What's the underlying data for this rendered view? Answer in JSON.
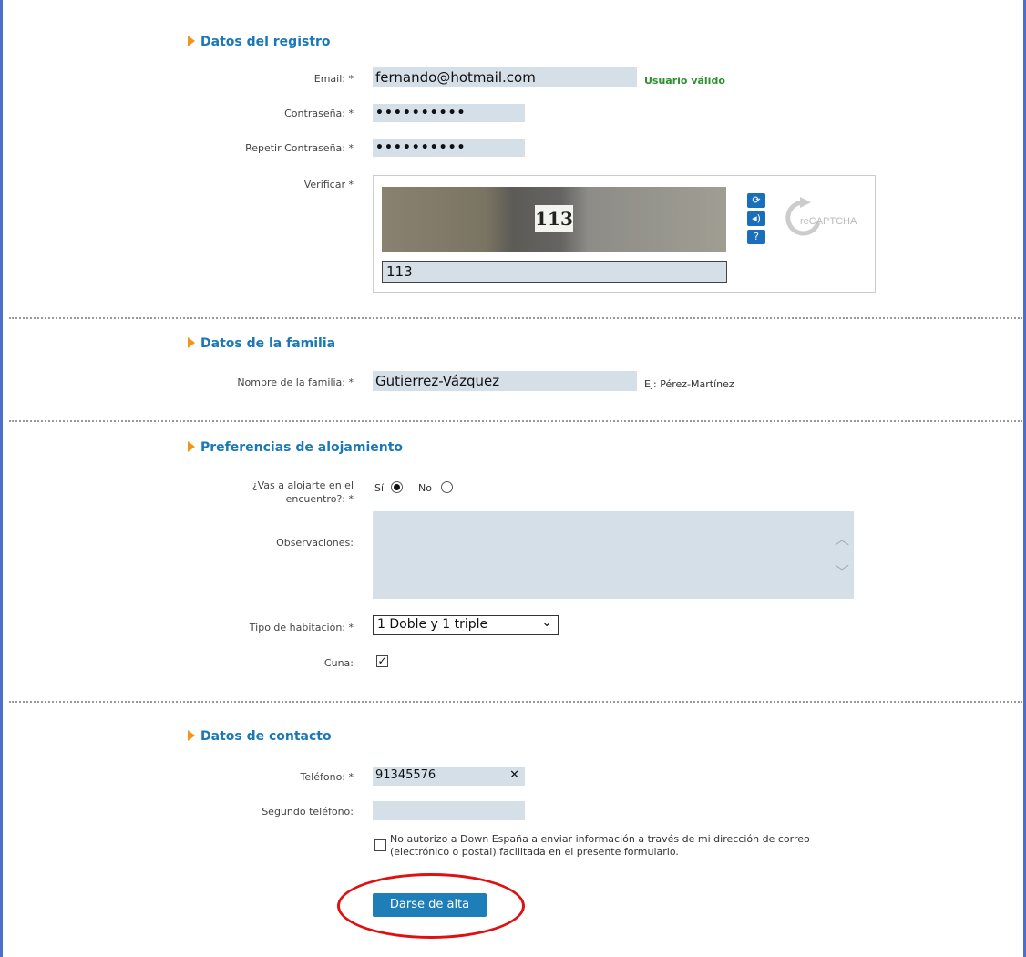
{
  "sections": {
    "registro": "Datos del registro",
    "familia": "Datos de la familia",
    "alojamiento": "Preferencias de alojamiento",
    "contacto": "Datos de contacto"
  },
  "registro": {
    "email_label": "Email: *",
    "email_value": "fernando@hotmail.com",
    "email_status": "Usuario válido",
    "password_label": "Contraseña: *",
    "password_value": "••••••••••",
    "repeat_label": "Repetir Contraseña: *",
    "repeat_value": "••••••••••",
    "verify_label": "Verificar *",
    "captcha_image_text": "113",
    "captcha_input": "113",
    "captcha_logo": "reCAPTCHA™"
  },
  "familia": {
    "name_label": "Nombre de la familia: *",
    "name_value": "Gutierrez-Vázquez",
    "name_hint": "Ej: Pérez-Martínez"
  },
  "alojamiento": {
    "stay_label": "¿Vas a alojarte en el encuentro?: *",
    "yes_label": "Sí",
    "no_label": "No",
    "observations_label": "Observaciones:",
    "room_label": "Tipo de habitación: *",
    "room_value": "1 Doble y 1 triple",
    "crib_label": "Cuna:"
  },
  "contacto": {
    "phone_label": "Teléfono: *",
    "phone_value": "91345576",
    "phone2_label": "Segundo teléfono:",
    "legal_text": "No autorizo a Down España a enviar información a través de mi dirección de correo (electrónico o postal) facilitada en el presente formulario.",
    "submit_label": "Darse de alta"
  },
  "colors": {
    "accent": "#1a78b8",
    "field_bg": "#d5dfe8",
    "arrow": "#f29418",
    "highlight": "#e01010"
  }
}
